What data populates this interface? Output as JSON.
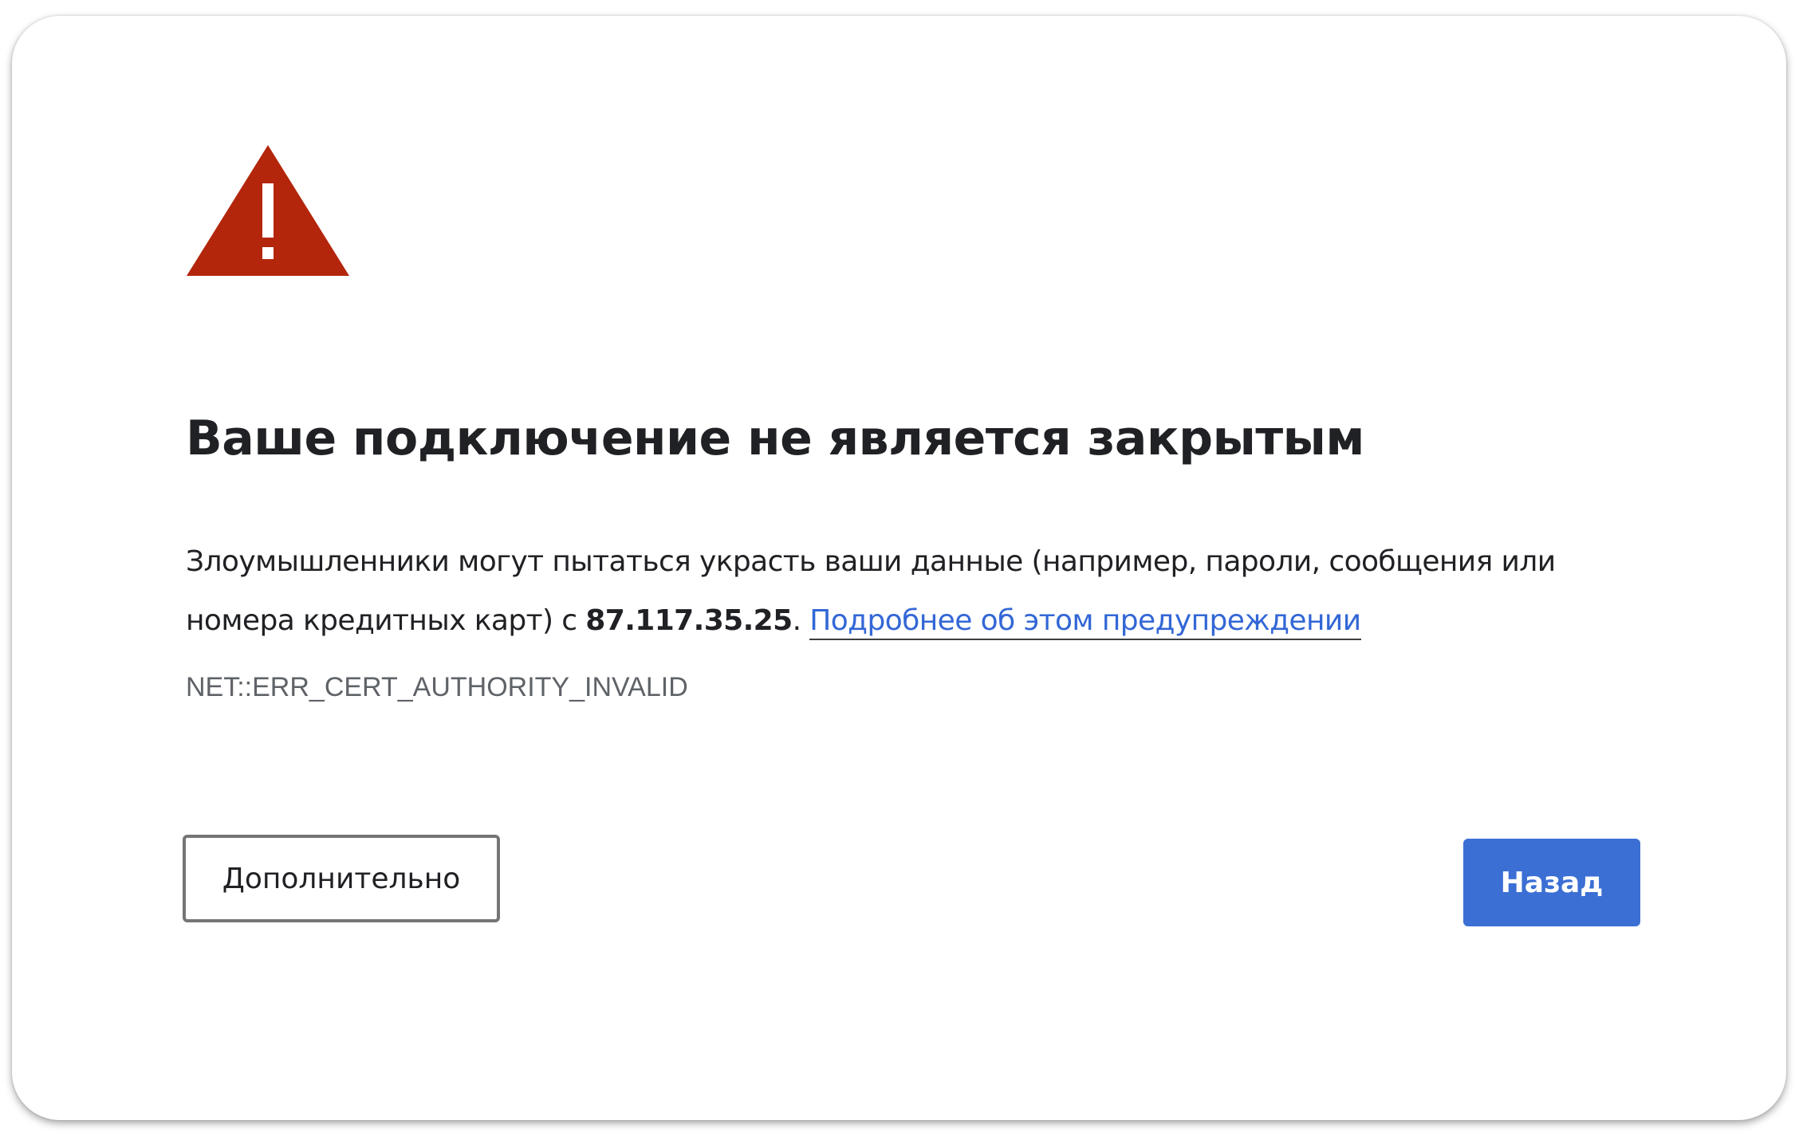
{
  "page": {
    "title": "Ваше подключение не является закрытым",
    "message": {
      "line1": "Злоумышленники могут пытаться украсть ваши данные (например, пароли, сообщения или",
      "line2_prefix": "номера кредитных карт) с ",
      "host": "87.117.35.25",
      "line2_suffix": ". ",
      "learn_more": "Подробнее об этом предупреждении"
    },
    "error_code": "NET::ERR_CERT_AUTHORITY_INVALID"
  },
  "buttons": {
    "advanced_label": "Дополнительно",
    "back_label": "Назад"
  },
  "icons": {
    "warning": "warning-triangle-icon"
  },
  "colors": {
    "warning_red": "#b3260b",
    "primary_blue": "#3b6fd4",
    "link_blue": "#3367d6",
    "text": "#202124",
    "muted": "#5f6368"
  }
}
